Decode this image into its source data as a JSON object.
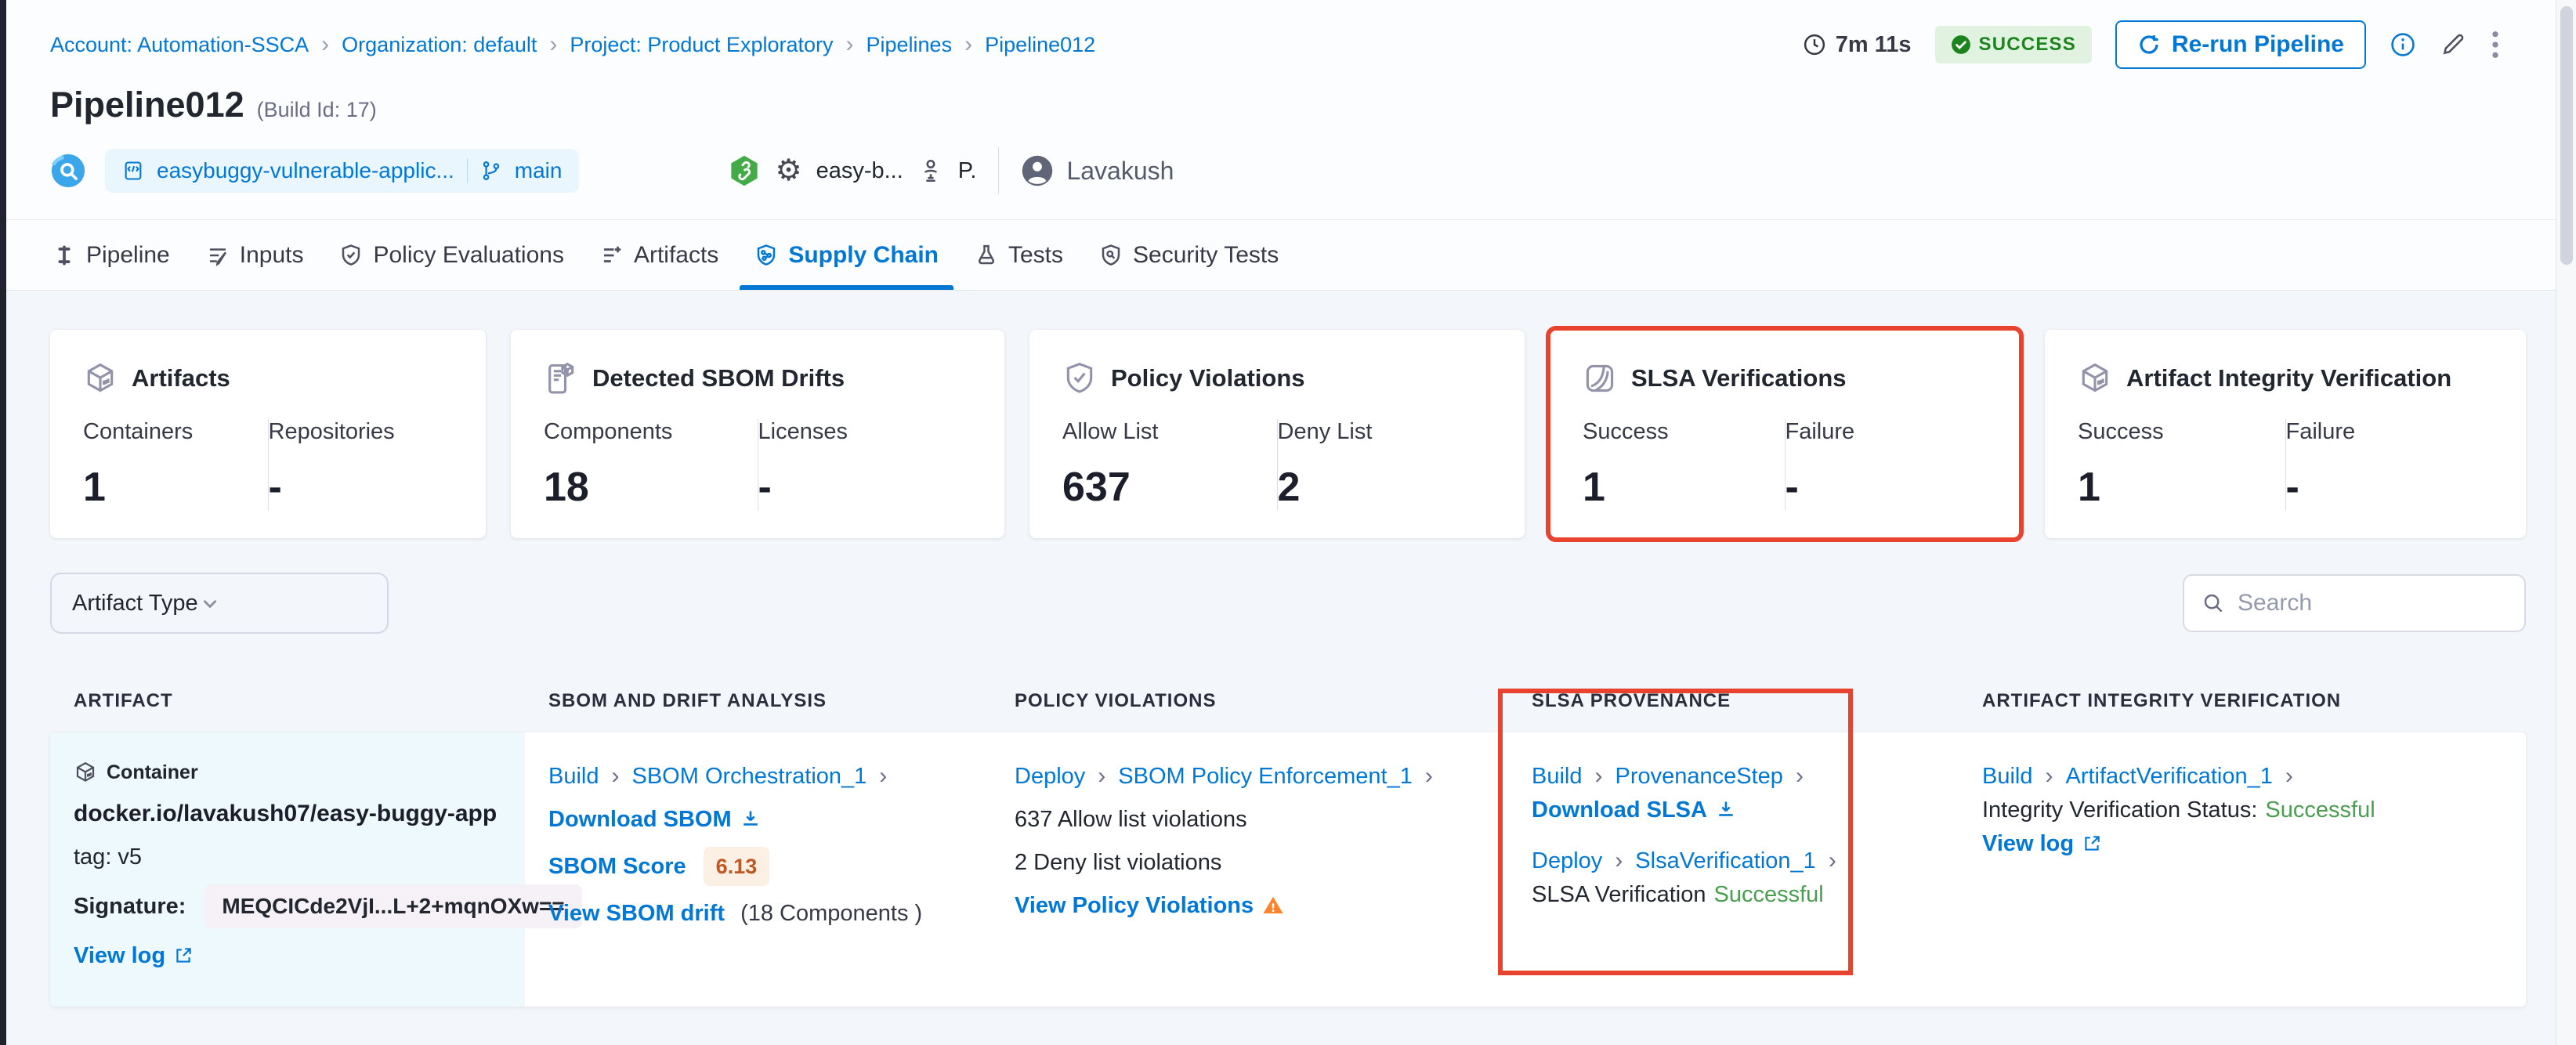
{
  "breadcrumb": {
    "separator": "›",
    "items": [
      "Account: Automation-SSCA",
      "Organization: default",
      "Project: Product Exploratory",
      "Pipelines",
      "Pipeline012"
    ]
  },
  "header": {
    "duration": "7m 11s",
    "status": "SUCCESS",
    "rerun_label": "Re-run Pipeline",
    "title": "Pipeline012",
    "build_id": "(Build Id: 17)",
    "repo_name": "easybuggy-vulnerable-applic...",
    "branch": "main",
    "service": "easy-b...",
    "trigger": "P.",
    "user": "Lavakush"
  },
  "tabs": [
    {
      "label": "Pipeline"
    },
    {
      "label": "Inputs"
    },
    {
      "label": "Policy Evaluations"
    },
    {
      "label": "Artifacts"
    },
    {
      "label": "Supply Chain"
    },
    {
      "label": "Tests"
    },
    {
      "label": "Security Tests"
    }
  ],
  "cards": [
    {
      "title": "Artifacts",
      "stats": [
        {
          "label": "Containers",
          "value": "1"
        },
        {
          "label": "Repositories",
          "value": "-"
        }
      ]
    },
    {
      "title": "Detected SBOM Drifts",
      "stats": [
        {
          "label": "Components",
          "value": "18"
        },
        {
          "label": "Licenses",
          "value": "-"
        }
      ]
    },
    {
      "title": "Policy Violations",
      "stats": [
        {
          "label": "Allow List",
          "value": "637"
        },
        {
          "label": "Deny List",
          "value": "2"
        }
      ]
    },
    {
      "title": "SLSA Verifications",
      "highlighted": true,
      "stats": [
        {
          "label": "Success",
          "value": "1"
        },
        {
          "label": "Failure",
          "value": "-"
        }
      ]
    },
    {
      "title": "Artifact Integrity Verification",
      "stats": [
        {
          "label": "Success",
          "value": "1"
        },
        {
          "label": "Failure",
          "value": "-"
        }
      ]
    }
  ],
  "filters": {
    "artifact_type_label": "Artifact Type",
    "search_placeholder": "Search"
  },
  "table": {
    "columns": [
      "ARTIFACT",
      "SBOM AND DRIFT ANALYSIS",
      "POLICY VIOLATIONS",
      "SLSA PROVENANCE",
      "ARTIFACT INTEGRITY VERIFICATION"
    ],
    "row": {
      "artifact": {
        "type": "Container",
        "image": "docker.io/lavakush07/easy-buggy-app",
        "tag": "tag: v5",
        "signature_label": "Signature:",
        "signature": "MEQCICde2VjI...L+2+mqnOXw==",
        "view_log": "View log"
      },
      "sbom": {
        "stage": "Build",
        "step": "SBOM Orchestration_1",
        "download": "Download SBOM",
        "score_label": "SBOM Score",
        "score": "6.13",
        "drift_link": "View SBOM drift",
        "drift_count": "(18 Components )"
      },
      "policy": {
        "stage": "Deploy",
        "step": "SBOM Policy Enforcement_1",
        "allow": "637 Allow list violations",
        "deny": "2 Deny list violations",
        "view": "View Policy Violations"
      },
      "slsa": {
        "stage1": "Build",
        "step1": "ProvenanceStep",
        "download": "Download SLSA",
        "stage2": "Deploy",
        "step2": "SlsaVerification_1",
        "status_label": "SLSA Verification",
        "status": "Successful"
      },
      "integrity": {
        "stage": "Build",
        "step": "ArtifactVerification_1",
        "status_label": "Integrity Verification Status:",
        "status": "Successful",
        "view_log": "View log"
      }
    }
  },
  "colors": {
    "accent": "#0278d5",
    "success_text": "#1b841d",
    "success_bg": "#e1f3e0",
    "status_green": "#4a9e50",
    "highlight_red": "#e8432e",
    "warning_orange": "#ff832b",
    "score_text": "#c05621",
    "score_bg": "#fcf0e4"
  }
}
